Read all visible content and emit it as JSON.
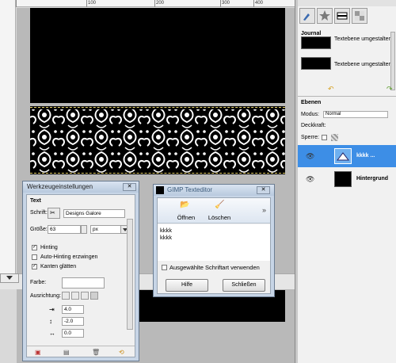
{
  "ruler": {
    "ticks": [
      "100",
      "200",
      "300",
      "400"
    ]
  },
  "right_panel": {
    "journal_title": "Journal",
    "journal_items": [
      {
        "label": "Textebene umgestalten"
      },
      {
        "label": "Textebene umgestalten"
      }
    ],
    "ebenen_title": "Ebenen",
    "modus_label": "Modus:",
    "modus_value": "Normal",
    "deckkraft_label": "Deckkraft:",
    "sperre_label": "Sperre:",
    "layers": [
      {
        "name": "kkkk ..."
      },
      {
        "name": "Hintergrund"
      }
    ]
  },
  "tool_dialog": {
    "title": "Werkzeugeinstellungen",
    "section": "Text",
    "font_label": "Schrift:",
    "font_value": "Designs Galore",
    "size_label": "Größe:",
    "size_value": "63",
    "size_unit": "px",
    "hinting_label": "Hinting",
    "autohinting_label": "Auto-Hinting erzwingen",
    "antialias_label": "Kanten glätten",
    "farbe_label": "Farbe:",
    "ausrichtung_label": "Ausrichtung:",
    "indent_value": "4.0",
    "line_spacing_value": "-2.0",
    "letter_spacing_value": "0.0"
  },
  "text_dialog": {
    "title": "GIMP Texteditor",
    "open_label": "Öffnen",
    "clear_label": "Löschen",
    "more_label": "»",
    "text_lines": [
      "kkkk",
      "kkkk"
    ],
    "use_font_label": "Ausgewählte Schriftart verwenden",
    "help_label": "Hilfe",
    "close_label": "Schließen"
  },
  "colors": {
    "canvas": "#000000",
    "selection_marquee": "#e8d36b",
    "layer_highlight": "#3d8ee6",
    "dialog_frame": "#c7d5e6"
  }
}
